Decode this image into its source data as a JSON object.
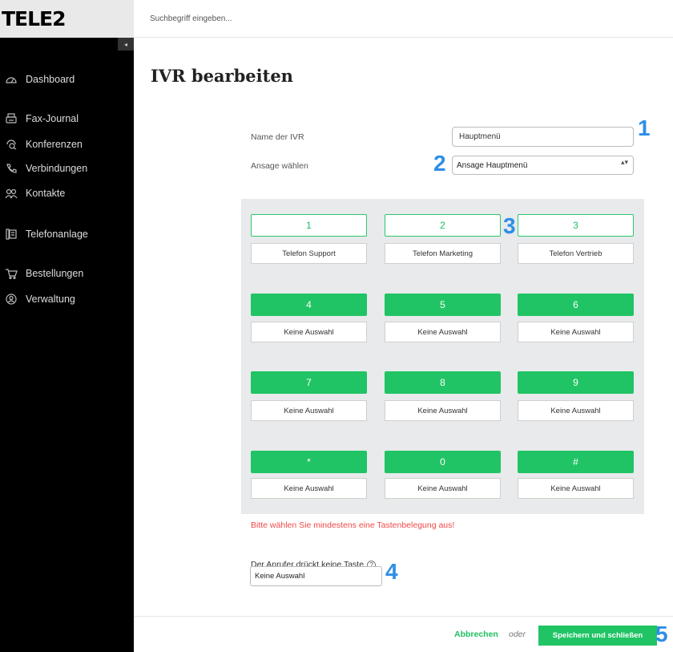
{
  "app": {
    "logo": "TELE2"
  },
  "colors": {
    "accent": "#20c464",
    "sidebar_bg": "#000000",
    "error": "#f04848",
    "annotation": "#2e8fe6"
  },
  "search": {
    "placeholder": "Suchbegriff eingeben..."
  },
  "sidebar": {
    "collapse_icon": "◂",
    "items": [
      {
        "label": "Dashboard",
        "icon": "dashboard-icon"
      },
      {
        "label": "Fax-Journal",
        "icon": "fax-icon"
      },
      {
        "label": "Konferenzen",
        "icon": "conference-icon"
      },
      {
        "label": "Verbindungen",
        "icon": "phone-icon"
      },
      {
        "label": "Kontakte",
        "icon": "contacts-icon"
      },
      {
        "label": "Telefonanlage",
        "icon": "phone-system-icon"
      },
      {
        "label": "Bestellungen",
        "icon": "cart-icon"
      },
      {
        "label": "Verwaltung",
        "icon": "user-icon"
      }
    ]
  },
  "main": {
    "title": "IVR bearbeiten",
    "name_label": "Name der IVR",
    "name_value": "Hauptmenü",
    "announcement_label": "Ansage wählen",
    "announcement_value": "Ansage Hauptmenü",
    "select_arrow": "▴▾",
    "keys": [
      {
        "key": "1",
        "assignment": "Telefon Support",
        "state": "empty"
      },
      {
        "key": "2",
        "assignment": "Telefon Marketing",
        "state": "empty"
      },
      {
        "key": "3",
        "assignment": "Telefon Vertrieb",
        "state": "empty"
      },
      {
        "key": "4",
        "assignment": "Keine Auswahl",
        "state": "filled"
      },
      {
        "key": "5",
        "assignment": "Keine Auswahl",
        "state": "filled"
      },
      {
        "key": "6",
        "assignment": "Keine Auswahl",
        "state": "filled"
      },
      {
        "key": "7",
        "assignment": "Keine Auswahl",
        "state": "filled"
      },
      {
        "key": "8",
        "assignment": "Keine Auswahl",
        "state": "filled"
      },
      {
        "key": "9",
        "assignment": "Keine Auswahl",
        "state": "filled"
      },
      {
        "key": "*",
        "assignment": "Keine Auswahl",
        "state": "filled"
      },
      {
        "key": "0",
        "assignment": "Keine Auswahl",
        "state": "filled"
      },
      {
        "key": "#",
        "assignment": "Keine Auswahl",
        "state": "filled"
      }
    ],
    "error_message": "Bitte wählen Sie mindestens eine Tastenbelegung aus!",
    "no_key_label": "Der Anrufer drückt keine Taste",
    "help_icon": "?",
    "no_key_value": "Keine Auswahl"
  },
  "annotations": [
    "1",
    "2",
    "3",
    "4",
    "5"
  ],
  "footer": {
    "cancel_label": "Abbrechen",
    "or_label": "oder",
    "save_label": "Speichern und schließen"
  }
}
